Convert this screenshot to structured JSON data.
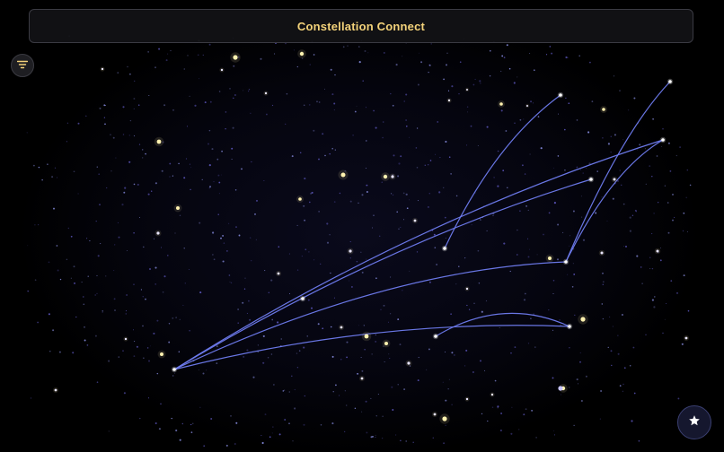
{
  "app": {
    "title": "Constellation Connect"
  },
  "controls": {
    "filter_icon": "filter-icon",
    "fab_icon": "star-icon"
  },
  "colors": {
    "title": "#f3d27a",
    "line": "#6f7cf0",
    "bright_star": "#fff2b0",
    "dim_star": "#c7c4ff",
    "background": "#000000"
  }
}
